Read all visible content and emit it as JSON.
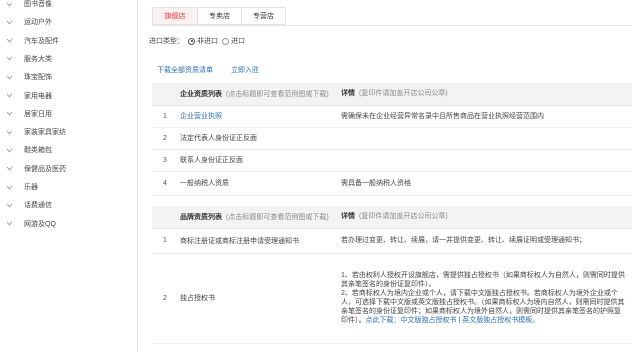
{
  "sidebar": {
    "items": [
      {
        "label": "图书音像"
      },
      {
        "label": "运动户外"
      },
      {
        "label": "汽车及配件"
      },
      {
        "label": "服务大类"
      },
      {
        "label": "珠宝配饰"
      },
      {
        "label": "家用电器"
      },
      {
        "label": "居家日用"
      },
      {
        "label": "家装家具家纺"
      },
      {
        "label": "鞋类箱包"
      },
      {
        "label": "保健品及医药"
      },
      {
        "label": "乐器"
      },
      {
        "label": "话费通信"
      },
      {
        "label": "网游及QQ"
      }
    ]
  },
  "tabs": [
    {
      "label": "旗舰店",
      "active": true
    },
    {
      "label": "专卖店",
      "active": false
    },
    {
      "label": "专营店",
      "active": false
    }
  ],
  "import_type": {
    "label": "进口类型：",
    "options": [
      {
        "label": "非进口",
        "checked": true
      },
      {
        "label": "进口",
        "checked": false
      }
    ]
  },
  "links": {
    "download_all": "下载全部资质清单",
    "join_now": "立即入驻"
  },
  "enterprise_table": {
    "header_title": "企业资质列表",
    "header_note": "(点击标题即可查看范例图或下载)",
    "detail_title": "详情",
    "detail_note": "(复印件请加盖开店公司公章)",
    "rows": [
      {
        "num": "1",
        "name": "企业营业执照",
        "detail": "需确保未在企业经营异常名录中且所售商品在营业执照经营范围内"
      },
      {
        "num": "2",
        "name": "法定代表人身份证正反面",
        "detail": ""
      },
      {
        "num": "3",
        "name": "联系人身份证正反面",
        "detail": ""
      },
      {
        "num": "4",
        "name": "一般纳税人资质",
        "detail": "需具备一般纳税人资格"
      }
    ]
  },
  "brand_table": {
    "header_title": "品牌资质列表",
    "header_note": "(点击标题即可查看范例图或下载)",
    "detail_title": "详情",
    "detail_note": "(复印件请加盖开店公司公章)",
    "rows": [
      {
        "num": "1",
        "name": "商标注册证或商标注册申请受理通知书",
        "detail": "若办理过变更、转让、续展，请一并提供变更、转让、续展证明或受理通知书；"
      },
      {
        "num": "2",
        "name": "独占授权书",
        "detail_lines": [
          "1、若由权利人授权开设旗舰店，需提供独占授权书（如果商标权人为自然人，则需同时提供其亲笔签名的身份证复印件）。",
          "2、若商标权人为境内企业或个人，请下载中文版独占授权书。若商标权人为境外企业或个人，可选择下载中文版或英文版独占授权书。（如果商标权人为境内自然人，则需同时提供其亲笔签名的身份证复印件；如果商标权人为境外自然人，则需同时提供其亲笔签名的护照复印件）。"
        ],
        "link_text": "点此下载：中文版独占授权书 | 英文版独占授权书模板。"
      }
    ]
  }
}
